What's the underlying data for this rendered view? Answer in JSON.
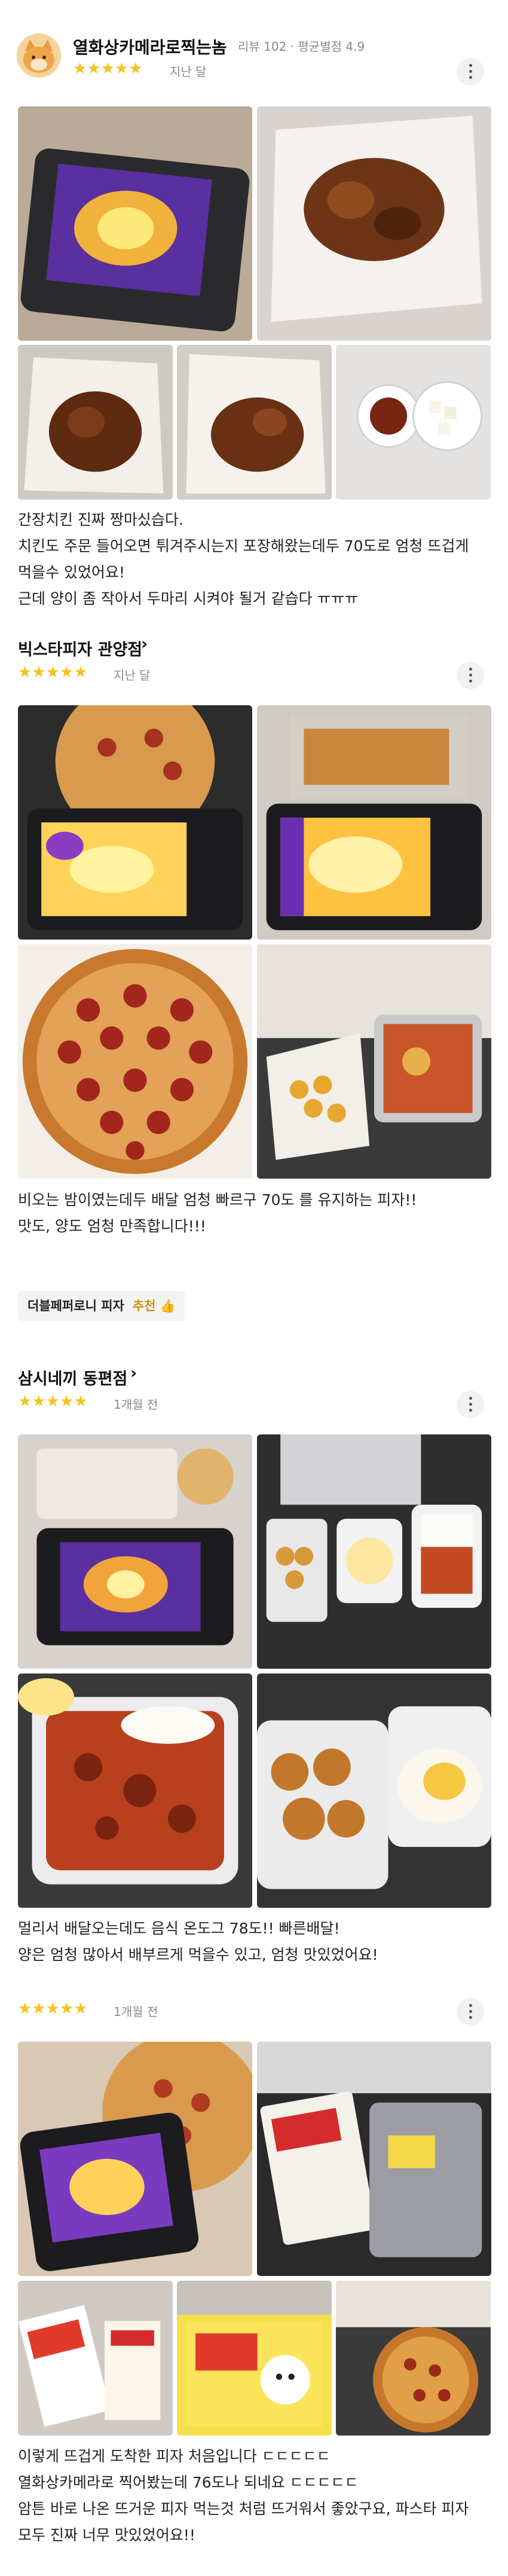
{
  "reviewer": {
    "name": "열화상카메라로찍는놈",
    "stats": "리뷰 102 · 평균별점 4.9",
    "stars": "★★★★★",
    "date": "지난 달"
  },
  "reviews": [
    {
      "text": [
        "간장치킨 진짜 짱마싰습다.",
        "치킨도 주문 들어오면 튀겨주시는지 포장해왔는데두 70도로 엄청 뜨겁게",
        "먹을수 있었어요!",
        "근데 양이 좀 작아서 두마리 시켜야 될거 같습다 ㅠㅠㅠ"
      ]
    },
    {
      "store": "빅스타피자 관양점",
      "stars": "★★★★★",
      "date": "지난 달",
      "text": [
        "비오는 밤이였는데두 배달 엄청 빠르구 70도 를 유지하는 피자!!",
        "맛도, 양도 엄청 만족합니다!!!"
      ],
      "menu_badge": "더블페퍼로니 피자",
      "recommend": "추천"
    },
    {
      "store": "삼시네끼 동편점",
      "stars": "★★★★★",
      "date": "1개월 전",
      "text": [
        "멀리서 배달오는데도 음식 온도그 78도!! 빠른배달!",
        "양은 엄청 많아서 배부르게 먹을수 있고, 엄청 맛있었어요!"
      ]
    },
    {
      "stars": "★★★★★",
      "date": "1개월 전",
      "text": [
        "이렇게 뜨겁게 도착한 피자 처음입니다 ㄷㄷㄷㄷㄷ",
        "열화상카메라로 찍어봤는데 76도나 되네요 ㄷㄷㄷㄷㄷ",
        "암튼 바로 나온 뜨거운 피자 먹는것 처럼 뜨거워서 좋았구요, 파스타 피자",
        "모두 진짜 너무 맛있었어요!!"
      ]
    }
  ],
  "icons": [
    "avatar-cat",
    "chevron-right-icon",
    "more-options-icon",
    "thumbs-up-icon",
    "star-icon"
  ],
  "colors": {
    "star": "#f7c21b",
    "meta": "#8a8a8a",
    "recommend": "#c79416"
  }
}
